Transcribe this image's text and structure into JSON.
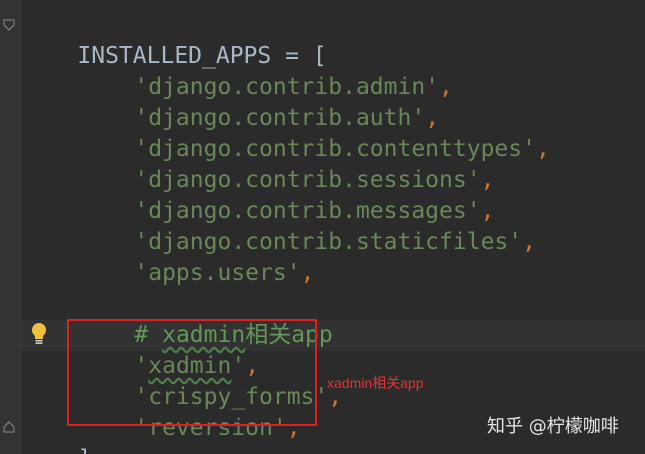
{
  "code": {
    "line1": {
      "name": "INSTALLED_APPS",
      "op": " = ",
      "bracket": "["
    },
    "apps": [
      {
        "str": "'django.contrib.admin'",
        "comma": ","
      },
      {
        "str": "'django.contrib.auth'",
        "comma": ","
      },
      {
        "str": "'django.contrib.contenttypes'",
        "comma": ","
      },
      {
        "str": "'django.contrib.sessions'",
        "comma": ","
      },
      {
        "str": "'django.contrib.messages'",
        "comma": ","
      },
      {
        "str": "'django.contrib.staticfiles'",
        "comma": ","
      },
      {
        "str": "'apps.users'",
        "comma": ","
      }
    ],
    "comment": {
      "hash": "# ",
      "word": "xadmin",
      "rest": "相关app"
    },
    "xadmin_apps": [
      {
        "quote_open": "'",
        "word": "xadmin",
        "quote_close": "'",
        "comma": ","
      },
      {
        "str": "'crispy_forms'",
        "comma": ","
      },
      {
        "str": "'reversion'",
        "comma": ","
      }
    ],
    "closing": "]"
  },
  "annotation": {
    "text": "xadmin相关app",
    "color": "#e83030"
  },
  "watermark": {
    "text": "知乎 @柠檬咖啡"
  },
  "icons": {
    "intention": "lightbulb-icon",
    "fold": "fold-marker-icon"
  },
  "colors": {
    "background": "#2b2b2b",
    "string": "#6a8759",
    "punctuation": "#cc7832",
    "comment": "#629755",
    "highlight_border": "#e02020"
  }
}
